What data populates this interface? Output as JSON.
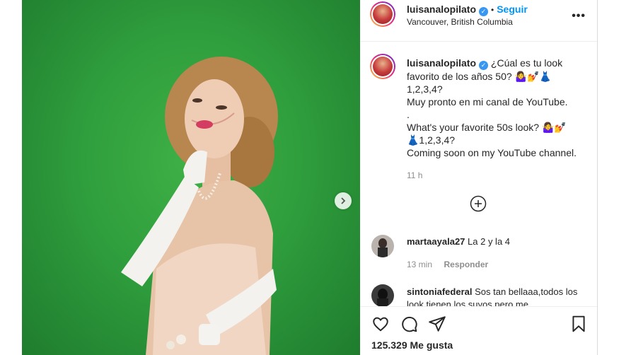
{
  "post": {
    "header": {
      "username": "luisanalopilato",
      "dot": "•",
      "follow_label": "Seguir",
      "location": "Vancouver, British Columbia"
    },
    "caption": {
      "username": "luisanalopilato",
      "text": "¿Cúal es tu look favorito de los años 50? 🤷‍♀️💅👗\n1,2,3,4?\nMuy pronto en mi canal de YouTube.\n.\nWhat's your favorite 50s look? 🤷‍♀️💅\n👗1,2,3,4?\nComing soon on my YouTube channel.",
      "time": "11 h"
    },
    "comments": [
      {
        "username": "martaayala27",
        "text": "La 2 y la 4",
        "time": "13 min",
        "reply_label": "Responder"
      },
      {
        "username": "sintoniafederal",
        "text": "Sos tan bellaaa,todos los look tienen los suyos pero me"
      }
    ],
    "likes": "125.329 Me gusta"
  },
  "icons": {
    "next": "chevron-right-icon",
    "more": "more-options-icon",
    "load_more": "plus-circle-icon",
    "like": "heart-icon",
    "comment": "comment-icon",
    "share": "paper-plane-icon",
    "save": "bookmark-icon"
  },
  "colors": {
    "accent": "#0095f6",
    "verified": "#3897f0",
    "background_green": "#2f9e3d"
  }
}
